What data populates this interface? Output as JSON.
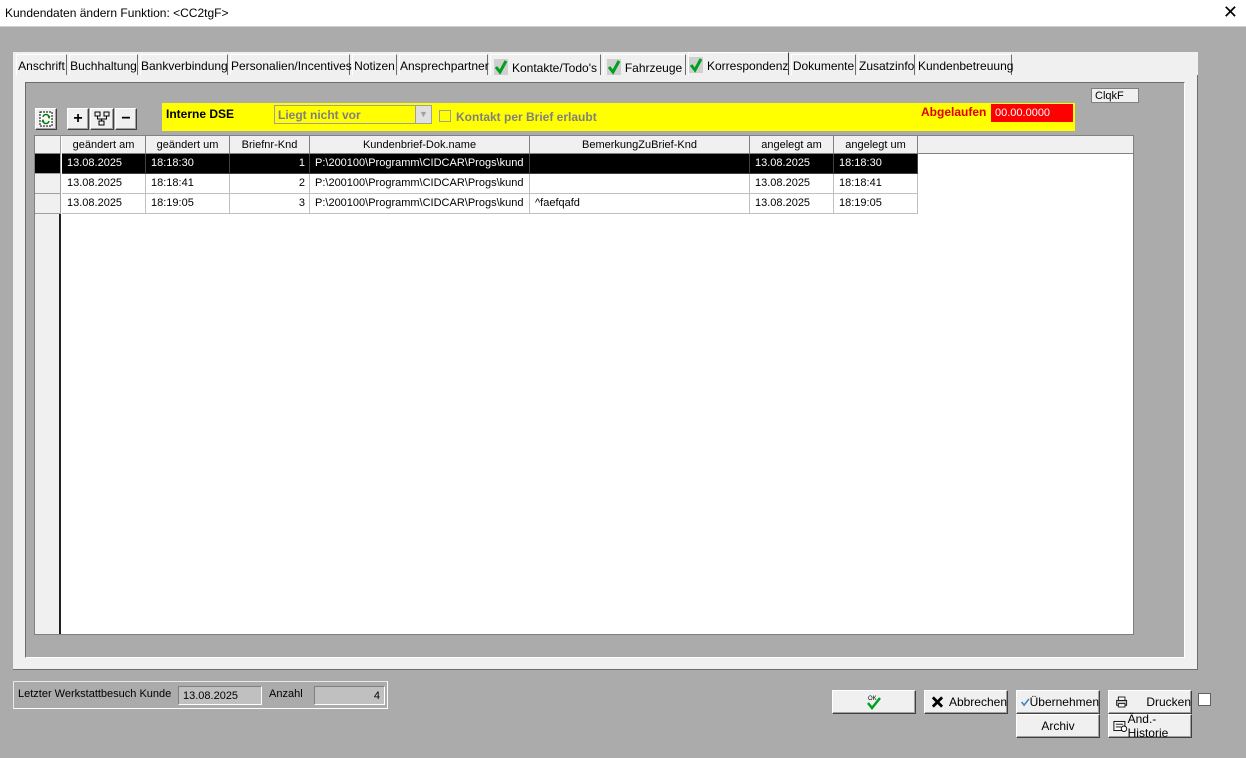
{
  "window": {
    "title": "Kundendaten ändern   Funktion: <CC2tgF>",
    "close_glyph": "✕"
  },
  "tabs": [
    {
      "label": "Anschrift",
      "checked": false
    },
    {
      "label": "Buchhaltung",
      "checked": false
    },
    {
      "label": "Bankverbindung",
      "checked": false
    },
    {
      "label": "Personalien/Incentives",
      "checked": false
    },
    {
      "label": "Notizen",
      "checked": false
    },
    {
      "label": "Ansprechpartner",
      "checked": false
    },
    {
      "label": "Kontakte/Todo's",
      "checked": true
    },
    {
      "label": "Fahrzeuge",
      "checked": true
    },
    {
      "label": "Korrespondenz",
      "checked": true,
      "active": true
    },
    {
      "label": "Dokumente",
      "checked": false
    },
    {
      "label": "Zusatzinfo",
      "checked": false
    },
    {
      "label": "Kundenbetreuung",
      "checked": false
    }
  ],
  "toolbar": {
    "refresh_icon": "refresh-icon",
    "add_label": "+",
    "tree_icon": "tree-icon",
    "remove_label": "−"
  },
  "dse": {
    "title": "Interne DSE",
    "combo_value": "Liegt nicht vor",
    "contact_letter_label": "Kontakt per Brief erlaubt",
    "contact_letter_checked": false,
    "expired_label": "Abgelaufen",
    "expired_value": "00.00.0000"
  },
  "corner_label": "ClqkF",
  "grid": {
    "columns": [
      "geändert am",
      "geändert um",
      "Briefnr-Knd",
      "Kundenbrief-Dok.name",
      "BemerkungZuBrief-Knd",
      "angelegt am",
      "angelegt um"
    ],
    "rows": [
      [
        "13.08.2025",
        "18:18:30",
        "1",
        "P:\\200100\\Programm\\CIDCAR\\Progs\\kund",
        "",
        "13.08.2025",
        "18:18:30"
      ],
      [
        "13.08.2025",
        "18:18:41",
        "2",
        "P:\\200100\\Programm\\CIDCAR\\Progs\\kund",
        "",
        "13.08.2025",
        "18:18:41"
      ],
      [
        "13.08.2025",
        "18:19:05",
        "3",
        "P:\\200100\\Programm\\CIDCAR\\Progs\\kund",
        "^faefqafd",
        "13.08.2025",
        "18:19:05"
      ]
    ],
    "selected_row": 0
  },
  "footer": {
    "last_visit_label": "Letzter Werkstattbesuch Kunde",
    "last_visit_value": "13.08.2025",
    "count_label": "Anzahl",
    "count_value": "4"
  },
  "buttons": {
    "ok_label": "",
    "cancel_label": "Abbrechen",
    "apply_label": "Übernehmen",
    "print_label": "Drucken",
    "archive_label": "Archiv",
    "history_label": "Änd.-Historie"
  },
  "colors": {
    "accent_yellow": "#ffff00",
    "expired_red": "#ff0000",
    "check_green": "#00a020"
  }
}
